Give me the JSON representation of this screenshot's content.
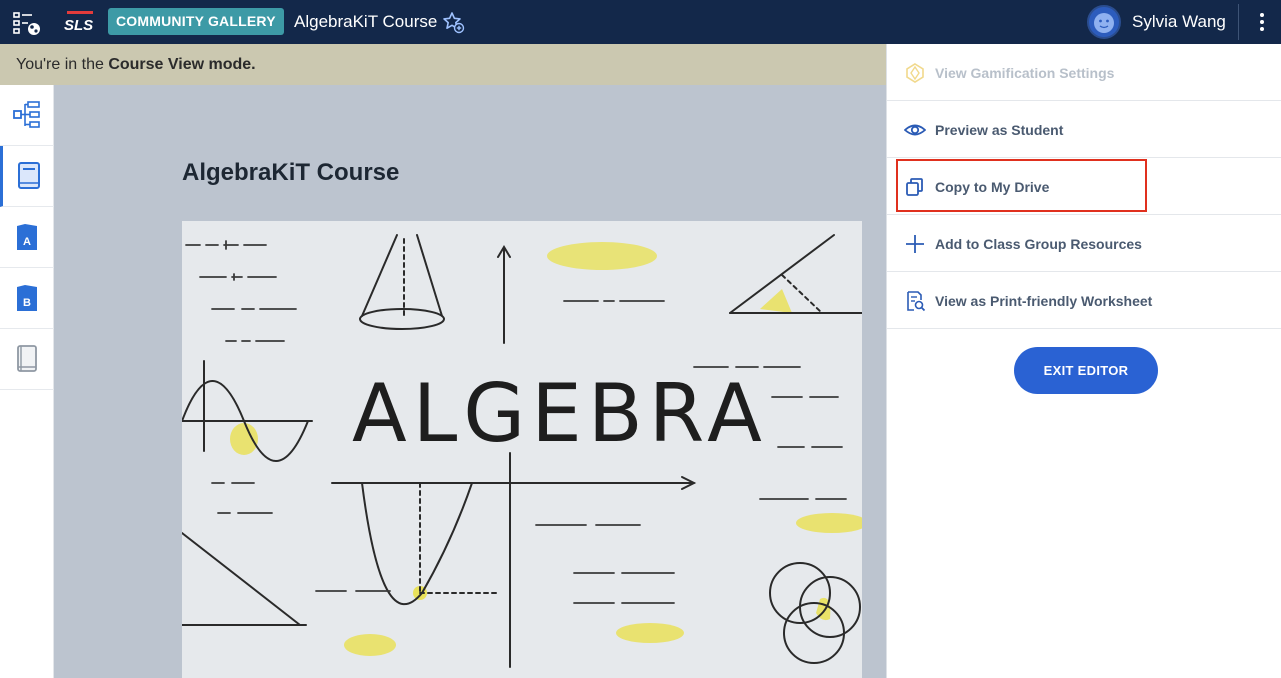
{
  "header": {
    "brand": "SLS",
    "badge": "COMMUNITY GALLERY",
    "course_title": "AlgebraKiT Course",
    "user_name": "Sylvia Wang"
  },
  "banner": {
    "prefix": "You're in the ",
    "mode": "Course View mode."
  },
  "main": {
    "title": "AlgebraKiT Course",
    "hero_text": "ALGEBRA"
  },
  "sidebar": {
    "items": [
      {
        "icon": "tree-structure-icon"
      },
      {
        "icon": "book-icon",
        "active": true
      },
      {
        "icon": "folder-a-icon",
        "letter": "A"
      },
      {
        "icon": "folder-b-icon",
        "letter": "B"
      },
      {
        "icon": "notebook-icon"
      }
    ]
  },
  "menu": {
    "items": [
      {
        "label": "View Gamification Settings",
        "icon": "gamification-icon",
        "disabled": true
      },
      {
        "label": "Preview as Student",
        "icon": "eye-icon"
      },
      {
        "label": "Copy to My Drive",
        "icon": "copy-icon"
      },
      {
        "label": "Add to Class Group Resources",
        "icon": "plus-icon"
      },
      {
        "label": "View as Print-friendly Worksheet",
        "icon": "worksheet-icon"
      }
    ],
    "exit_label": "EXIT EDITOR"
  },
  "colors": {
    "topbar": "#13284a",
    "badge": "#3d9aa6",
    "accent": "#2a62d3",
    "highlight": "#e0301e"
  }
}
